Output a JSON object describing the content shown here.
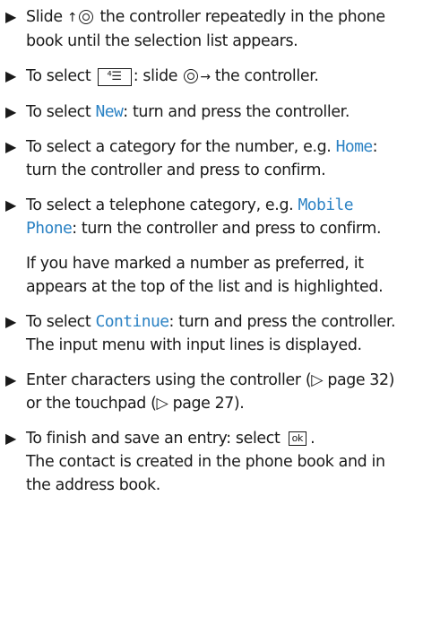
{
  "bullet_glyph": "▶",
  "icons": {
    "controller": "controller-icon",
    "arrow_up": "↑",
    "arrow_right": "→",
    "menu_button": "list-menu-icon",
    "ok_button": "ok"
  },
  "colors": {
    "highlight": "#2b82c4",
    "text": "#1a1a1a"
  },
  "steps": [
    {
      "a": "Slide",
      "b": "the controller repeatedly in the phone book until the selection list appears."
    },
    {
      "a": "To select",
      "menu_label": "⁴☰",
      "b": ": slide",
      "c": "the controller."
    },
    {
      "a": "To select",
      "hl": "New",
      "b": ": turn and press the controller."
    },
    {
      "a": "To select a category for the number, e.g.",
      "hl": "Home",
      "b": ": turn the controller and press to confirm."
    },
    {
      "a": "To select a telephone category, e.g.",
      "hl": "Mobile Phone",
      "b": ": turn the controller and press to confirm.",
      "note": "If you have marked a number as preferred, it appears at the top of the list and is highlighted."
    },
    {
      "a": "To select",
      "hl": "Continue",
      "b": ": turn and press the controller.",
      "note": "The input menu with input lines is displayed."
    },
    {
      "a": "Enter characters using the controller",
      "ref1": "(▷ page 32)",
      "b": "or the touchpad",
      "ref2": "(▷ page 27)."
    },
    {
      "a": "To finish and save an entry: select",
      "ok_label": "ok",
      "b": ".",
      "note": "The contact is created in the phone book and in the address book."
    }
  ]
}
